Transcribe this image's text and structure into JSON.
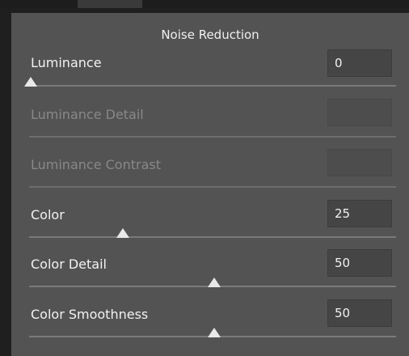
{
  "panel": {
    "title": "Noise Reduction",
    "sliders": [
      {
        "label": "Luminance",
        "value": "0",
        "fraction": 0.0,
        "enabled": true
      },
      {
        "label": "Luminance Detail",
        "value": "",
        "enabled": false
      },
      {
        "label": "Luminance Contrast",
        "value": "",
        "enabled": false
      },
      {
        "label": "Color",
        "value": "25",
        "fraction": 0.25,
        "enabled": true
      },
      {
        "label": "Color Detail",
        "value": "50",
        "fraction": 0.5,
        "enabled": true
      },
      {
        "label": "Color Smoothness",
        "value": "50",
        "fraction": 0.5,
        "enabled": true
      }
    ]
  },
  "colors": {
    "panel_bg": "#535353",
    "track": "#7a7a7a",
    "thumb": "#e8e8e8",
    "disabled_text": "#888888"
  }
}
